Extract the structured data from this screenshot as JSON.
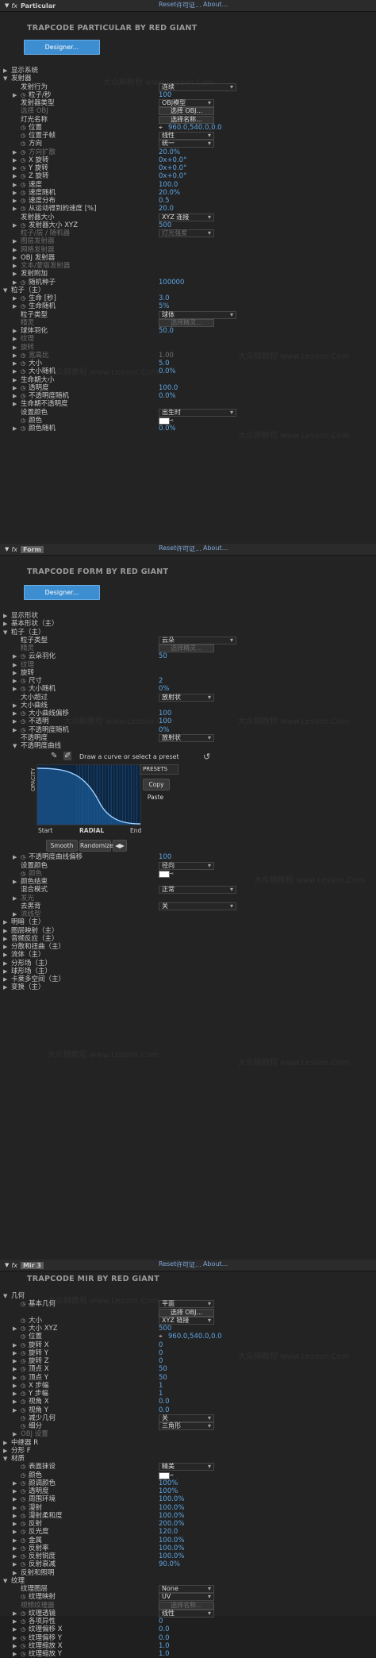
{
  "panels": [
    {
      "fx": "fx",
      "name": "Particular",
      "tagged": false,
      "reset": "Reset",
      "license": "许可证...",
      "about": "About...",
      "brand": "TRAPCODE PARTICULAR BY RED GIANT",
      "designer": "Designer...",
      "rows": [
        {
          "d": 0,
          "tw": "▶",
          "sw": "",
          "lbl": "显示系统"
        },
        {
          "d": 0,
          "tw": "▼",
          "sw": "",
          "lbl": "发射器"
        },
        {
          "d": 1,
          "tw": "",
          "sw": "",
          "lbl": "发射行为",
          "sel": "连续",
          "selw": 98
        },
        {
          "d": 1,
          "tw": "▶",
          "sw": "◷",
          "lbl": "粒子/秒",
          "val": "100"
        },
        {
          "d": 1,
          "tw": "",
          "sw": "",
          "lbl": "发射器类型",
          "sel": "OBJ模型",
          "selw": 70
        },
        {
          "d": 1,
          "tw": "",
          "sw": "",
          "lbl": "选择 OBJ",
          "dimlbl": true,
          "btn": "选择 OBJ...",
          "btnw": 70
        },
        {
          "d": 1,
          "tw": "",
          "sw": "",
          "lbl": "灯光名称",
          "btn": "选择名称...",
          "btnw": 70
        },
        {
          "d": 1,
          "tw": "",
          "sw": "◷",
          "lbl": "位置",
          "val": "960.0,540.0,0.0",
          "pos": true
        },
        {
          "d": 1,
          "tw": "",
          "sw": "◷",
          "lbl": "位置子帧",
          "sel": "线性",
          "selw": 70
        },
        {
          "d": 1,
          "tw": "",
          "sw": "◷",
          "lbl": "方向",
          "sel": "统一",
          "selw": 70
        },
        {
          "d": 1,
          "tw": "▶",
          "sw": "◷",
          "lbl": "方向扩散",
          "val": "20.0%",
          "dimlbl": true
        },
        {
          "d": 1,
          "tw": "▶",
          "sw": "◷",
          "lbl": "X 旋转",
          "val": "0x+0.0°"
        },
        {
          "d": 1,
          "tw": "▶",
          "sw": "◷",
          "lbl": "Y 旋转",
          "val": "0x+0.0°"
        },
        {
          "d": 1,
          "tw": "▶",
          "sw": "◷",
          "lbl": "Z 旋转",
          "val": "0x+0.0°"
        },
        {
          "d": 1,
          "tw": "▶",
          "sw": "◷",
          "lbl": "速度",
          "val": "100.0"
        },
        {
          "d": 1,
          "tw": "▶",
          "sw": "◷",
          "lbl": "速度随机",
          "val": "20.0%"
        },
        {
          "d": 1,
          "tw": "▶",
          "sw": "◷",
          "lbl": "速度分布",
          "val": "0.5"
        },
        {
          "d": 1,
          "tw": "▶",
          "sw": "◷",
          "lbl": "从运动得到的速度 [%]",
          "val": "20.0"
        },
        {
          "d": 1,
          "tw": "",
          "sw": "",
          "lbl": "发射器大小",
          "sel": "XYZ 连接",
          "selw": 70
        },
        {
          "d": 1,
          "tw": "▶",
          "sw": "◷",
          "lbl": "发射器大小 XYZ",
          "val": "500"
        },
        {
          "d": 1,
          "tw": "",
          "sw": "",
          "lbl": "粒子/层 / 随机器",
          "dimlbl": true,
          "sel": "灯光强度",
          "selw": 70,
          "dimsel": true
        },
        {
          "d": 1,
          "tw": "▶",
          "sw": "",
          "lbl": "图层发射器",
          "dimlbl": true
        },
        {
          "d": 1,
          "tw": "▶",
          "sw": "",
          "lbl": "网格发射器",
          "dimlbl": true
        },
        {
          "d": 1,
          "tw": "▶",
          "sw": "",
          "lbl": "OBJ 发射器"
        },
        {
          "d": 1,
          "tw": "▶",
          "sw": "",
          "lbl": "文本/蒙版发射器",
          "dimlbl": true
        },
        {
          "d": 1,
          "tw": "▶",
          "sw": "",
          "lbl": "发射附加"
        },
        {
          "d": 1,
          "tw": "▶",
          "sw": "◷",
          "lbl": "随机种子",
          "val": "100000"
        },
        {
          "d": 0,
          "tw": "▼",
          "sw": "",
          "lbl": "粒子（主）"
        },
        {
          "d": 1,
          "tw": "▶",
          "sw": "◷",
          "lbl": "生命 [秒]",
          "val": "3.0"
        },
        {
          "d": 1,
          "tw": "▶",
          "sw": "◷",
          "lbl": "生命随机",
          "val": "5%"
        },
        {
          "d": 1,
          "tw": "",
          "sw": "",
          "lbl": "粒子类型",
          "sel": "球体",
          "selw": 98
        },
        {
          "d": 1,
          "tw": "",
          "sw": "",
          "lbl": "精灵",
          "dimlbl": true,
          "btn": "选择精灵...",
          "btnw": 70,
          "dimbtn": true
        },
        {
          "d": 1,
          "tw": "▶",
          "sw": "",
          "lbl": "球体羽化",
          "val": "50.0"
        },
        {
          "d": 1,
          "tw": "▶",
          "sw": "",
          "lbl": "纹理",
          "dimlbl": true
        },
        {
          "d": 1,
          "tw": "▶",
          "sw": "",
          "lbl": "旋转",
          "dimlbl": true
        },
        {
          "d": 1,
          "tw": "▶",
          "sw": "◷",
          "lbl": "宽高比",
          "val": "1.00",
          "dimlbl": true,
          "dimval": true
        },
        {
          "d": 1,
          "tw": "▶",
          "sw": "◷",
          "lbl": "大小",
          "val": "5.0"
        },
        {
          "d": 1,
          "tw": "▶",
          "sw": "◷",
          "lbl": "大小随机",
          "val": "0.0%"
        },
        {
          "d": 1,
          "tw": "▶",
          "sw": "",
          "lbl": "生命期大小"
        },
        {
          "d": 1,
          "tw": "▶",
          "sw": "◷",
          "lbl": "透明度",
          "val": "100.0"
        },
        {
          "d": 1,
          "tw": "▶",
          "sw": "◷",
          "lbl": "不透明度随机",
          "val": "0.0%"
        },
        {
          "d": 1,
          "tw": "▶",
          "sw": "",
          "lbl": "生命期不透明度"
        },
        {
          "d": 1,
          "tw": "",
          "sw": "",
          "lbl": "设置颜色",
          "sel": "出生时",
          "selw": 98
        },
        {
          "d": 1,
          "tw": "",
          "sw": "◷",
          "lbl": "颜色",
          "swatch": true
        },
        {
          "d": 1,
          "tw": "▶",
          "sw": "◷",
          "lbl": "颜色随机",
          "val": "0.0%"
        }
      ]
    },
    {
      "fx": "fx",
      "name": "Form",
      "tagged": true,
      "reset": "Reset",
      "license": "许可证...",
      "about": "About...",
      "brand": "TRAPCODE FORM BY RED GIANT",
      "designer": "Designer...",
      "rows": [
        {
          "d": 0,
          "tw": "▶",
          "sw": "",
          "lbl": "显示形状"
        },
        {
          "d": 0,
          "tw": "▶",
          "sw": "",
          "lbl": "基本形状（主）"
        },
        {
          "d": 0,
          "tw": "▼",
          "sw": "",
          "lbl": "粒子（主）"
        },
        {
          "d": 1,
          "tw": "",
          "sw": "",
          "lbl": "粒子类型",
          "sel": "云朵",
          "selw": 98
        },
        {
          "d": 1,
          "tw": "",
          "sw": "",
          "lbl": "精灵",
          "dimlbl": true,
          "btn": "选择精灵...",
          "btnw": 70,
          "dimbtn": true
        },
        {
          "d": 1,
          "tw": "▶",
          "sw": "◷",
          "lbl": "云朵羽化",
          "val": "50"
        },
        {
          "d": 1,
          "tw": "▶",
          "sw": "",
          "lbl": "纹理",
          "dimlbl": true
        },
        {
          "d": 1,
          "tw": "▶",
          "sw": "",
          "lbl": "旋转"
        },
        {
          "d": 1,
          "tw": "▶",
          "sw": "◷",
          "lbl": "尺寸",
          "val": "2"
        },
        {
          "d": 1,
          "tw": "▶",
          "sw": "◷",
          "lbl": "大小随机",
          "val": "0%"
        },
        {
          "d": 1,
          "tw": "",
          "sw": "",
          "lbl": "大小超过",
          "sel": "放射状",
          "selw": 70
        },
        {
          "d": 1,
          "tw": "▶",
          "sw": "",
          "lbl": "大小曲线"
        },
        {
          "d": 1,
          "tw": "▶",
          "sw": "◷",
          "lbl": "大小曲线偏移",
          "val": "100"
        },
        {
          "d": 1,
          "tw": "▶",
          "sw": "◷",
          "lbl": "不透明",
          "val": "100"
        },
        {
          "d": 1,
          "tw": "▶",
          "sw": "◷",
          "lbl": "不透明度随机",
          "val": "0%"
        },
        {
          "d": 1,
          "tw": "",
          "sw": "",
          "lbl": "不透明度",
          "sel": "放射状",
          "selw": 70
        },
        {
          "d": 1,
          "tw": "▼",
          "sw": "",
          "lbl": "不透明度曲线"
        }
      ],
      "curve": {
        "hint": "Draw a curve or select a preset",
        "presets": "PRESETS",
        "copy": "Copy",
        "paste": "Paste",
        "ylabel": "OPACITY",
        "start": "Start",
        "mid": "RADIAL",
        "end": "End",
        "smooth": "Smooth",
        "randomize": "Randomize",
        "flip": "◀▶"
      },
      "rows2": [
        {
          "d": 1,
          "tw": "▶",
          "sw": "◷",
          "lbl": "不透明度曲线偏移",
          "val": "100"
        },
        {
          "d": 1,
          "tw": "",
          "sw": "",
          "lbl": "设置颜色",
          "sel": "径向",
          "selw": 70
        },
        {
          "d": 1,
          "tw": "",
          "sw": "◷",
          "lbl": "颜色",
          "dimlbl": true,
          "swatch": true
        },
        {
          "d": 1,
          "tw": "▶",
          "sw": "",
          "lbl": "颜色结束"
        },
        {
          "d": 1,
          "tw": "",
          "sw": "",
          "lbl": "混合模式",
          "sel": "正常",
          "selw": 98
        },
        {
          "d": 1,
          "tw": "▶",
          "sw": "",
          "lbl": "发光",
          "dimlbl": true
        },
        {
          "d": 1,
          "tw": "",
          "sw": "",
          "lbl": "去黑背",
          "sel": "关",
          "selw": 98
        },
        {
          "d": 1,
          "tw": "▶",
          "sw": "",
          "lbl": "流线型",
          "dimlbl": true
        },
        {
          "d": 0,
          "tw": "▶",
          "sw": "",
          "lbl": "明暗（主）"
        },
        {
          "d": 0,
          "tw": "▶",
          "sw": "",
          "lbl": "图层映射（主）"
        },
        {
          "d": 0,
          "tw": "▶",
          "sw": "",
          "lbl": "音频反应（主）"
        },
        {
          "d": 0,
          "tw": "▶",
          "sw": "",
          "lbl": "分散和扭曲（主）"
        },
        {
          "d": 0,
          "tw": "▶",
          "sw": "",
          "lbl": "流体（主）"
        },
        {
          "d": 0,
          "tw": "▶",
          "sw": "",
          "lbl": "分形场（主）"
        },
        {
          "d": 0,
          "tw": "▶",
          "sw": "",
          "lbl": "球形场（主）"
        },
        {
          "d": 0,
          "tw": "▶",
          "sw": "",
          "lbl": "卡莱多空间（主）"
        },
        {
          "d": 0,
          "tw": "▶",
          "sw": "",
          "lbl": "变换（主）"
        }
      ]
    },
    {
      "fx": "fx",
      "name": "Mir 3",
      "tagged": true,
      "reset": "Reset",
      "license": "许可证...",
      "about": "About...",
      "brand": "TRAPCODE MIR BY RED GIANT",
      "rows": [
        {
          "d": 0,
          "tw": "▼",
          "sw": "",
          "lbl": "几何"
        },
        {
          "d": 1,
          "tw": "",
          "sw": "◷",
          "lbl": "基本几何",
          "sel": "平面",
          "selw": 70
        },
        {
          "d": 1,
          "tw": "",
          "sw": "",
          "lbl": "",
          "btn": "选择 OBJ...",
          "btnw": 70
        },
        {
          "d": 1,
          "tw": "",
          "sw": "◷",
          "lbl": "大小",
          "sel": "XYZ 链接",
          "selw": 70
        },
        {
          "d": 1,
          "tw": "▶",
          "sw": "◷",
          "lbl": "大小 XYZ",
          "val": "500"
        },
        {
          "d": 1,
          "tw": "",
          "sw": "◷",
          "lbl": "位置",
          "val": "960.0,540.0,0.0",
          "pos": true
        },
        {
          "d": 1,
          "tw": "▶",
          "sw": "◷",
          "lbl": "旋转 X",
          "val": "0"
        },
        {
          "d": 1,
          "tw": "▶",
          "sw": "◷",
          "lbl": "旋转 Y",
          "val": "0"
        },
        {
          "d": 1,
          "tw": "▶",
          "sw": "◷",
          "lbl": "旋转 Z",
          "val": "0"
        },
        {
          "d": 1,
          "tw": "▶",
          "sw": "◷",
          "lbl": "顶点 X",
          "val": "50"
        },
        {
          "d": 1,
          "tw": "▶",
          "sw": "◷",
          "lbl": "顶点 Y",
          "val": "50"
        },
        {
          "d": 1,
          "tw": "▶",
          "sw": "◷",
          "lbl": "X 步幅",
          "val": "1"
        },
        {
          "d": 1,
          "tw": "▶",
          "sw": "◷",
          "lbl": "Y 步幅",
          "val": "1"
        },
        {
          "d": 1,
          "tw": "▶",
          "sw": "◷",
          "lbl": "视角 X",
          "val": "0.0"
        },
        {
          "d": 1,
          "tw": "▶",
          "sw": "◷",
          "lbl": "视角 Y",
          "val": "0.0"
        },
        {
          "d": 1,
          "tw": "",
          "sw": "◷",
          "lbl": "减少几何",
          "sel": "关",
          "selw": 70
        },
        {
          "d": 1,
          "tw": "",
          "sw": "◷",
          "lbl": "细分",
          "sel": "三角形",
          "selw": 70
        },
        {
          "d": 1,
          "tw": "▶",
          "sw": "",
          "lbl": "OBJ 设置",
          "dimlbl": true
        },
        {
          "d": 0,
          "tw": "▶",
          "sw": "",
          "lbl": "中继器 R"
        },
        {
          "d": 0,
          "tw": "▶",
          "sw": "",
          "lbl": "分形 F"
        },
        {
          "d": 0,
          "tw": "▼",
          "sw": "",
          "lbl": "材质"
        },
        {
          "d": 1,
          "tw": "",
          "sw": "◷",
          "lbl": "表面抹设",
          "sel": "精美",
          "selw": 70
        },
        {
          "d": 1,
          "tw": "",
          "sw": "◷",
          "lbl": "颜色",
          "swatch": true
        },
        {
          "d": 1,
          "tw": "▶",
          "sw": "◷",
          "lbl": "颜调颜色",
          "val": "100%"
        },
        {
          "d": 1,
          "tw": "▶",
          "sw": "◷",
          "lbl": "透明度",
          "val": "100%"
        },
        {
          "d": 1,
          "tw": "▶",
          "sw": "◷",
          "lbl": "周围环境",
          "val": "100.0%"
        },
        {
          "d": 1,
          "tw": "▶",
          "sw": "◷",
          "lbl": "漫射",
          "val": "100.0%"
        },
        {
          "d": 1,
          "tw": "▶",
          "sw": "◷",
          "lbl": "漫射柔和度",
          "val": "100.0%"
        },
        {
          "d": 1,
          "tw": "▶",
          "sw": "◷",
          "lbl": "反射",
          "val": "200.0%"
        },
        {
          "d": 1,
          "tw": "▶",
          "sw": "◷",
          "lbl": "反光度",
          "val": "120.0"
        },
        {
          "d": 1,
          "tw": "▶",
          "sw": "◷",
          "lbl": "金属",
          "val": "100.0%"
        },
        {
          "d": 1,
          "tw": "▶",
          "sw": "◷",
          "lbl": "反射率",
          "val": "100.0%"
        },
        {
          "d": 1,
          "tw": "▶",
          "sw": "◷",
          "lbl": "反射锐度",
          "val": "100.0%"
        },
        {
          "d": 1,
          "tw": "▶",
          "sw": "◷",
          "lbl": "反射衰减",
          "val": "90.0%"
        },
        {
          "d": 1,
          "tw": "▶",
          "sw": "",
          "lbl": "反射和照明"
        },
        {
          "d": 0,
          "tw": "▼",
          "sw": "",
          "lbl": "纹理"
        },
        {
          "d": 1,
          "tw": "",
          "sw": "",
          "lbl": "纹理图层",
          "sel": "None",
          "selw": 70
        },
        {
          "d": 1,
          "tw": "",
          "sw": "◷",
          "lbl": "纹理映射",
          "sel": "UV",
          "selw": 70
        },
        {
          "d": 1,
          "tw": "",
          "sw": "",
          "lbl": "视频纹理器",
          "dimlbl": true,
          "btn": "选择名称...",
          "btnw": 70,
          "dimbtn": true
        },
        {
          "d": 1,
          "tw": "▶",
          "sw": "◷",
          "lbl": "纹理透镜",
          "sel": "线性",
          "selw": 70
        },
        {
          "d": 1,
          "tw": "▶",
          "sw": "◷",
          "lbl": "各项异性",
          "val": "0"
        },
        {
          "d": 1,
          "tw": "▶",
          "sw": "◷",
          "lbl": "纹理偏移 X",
          "val": "0.0"
        },
        {
          "d": 1,
          "tw": "▶",
          "sw": "◷",
          "lbl": "纹理偏移 Y",
          "val": "0.0"
        },
        {
          "d": 1,
          "tw": "▶",
          "sw": "◷",
          "lbl": "纹理缩放 X",
          "val": "1.0"
        },
        {
          "d": 1,
          "tw": "▶",
          "sw": "◷",
          "lbl": "纹理缩放 Y",
          "val": "1.0"
        }
      ]
    }
  ],
  "watermark": "大众脚教程 www.Lesson.Com"
}
